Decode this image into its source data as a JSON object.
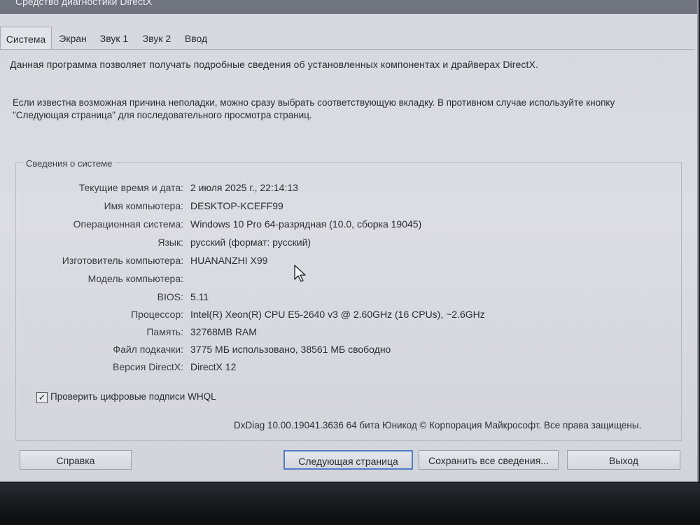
{
  "window": {
    "title": "Средство диагностики DirectX"
  },
  "tabs": [
    {
      "label": "Система",
      "active": true
    },
    {
      "label": "Экран"
    },
    {
      "label": "Звук 1"
    },
    {
      "label": "Звук 2"
    },
    {
      "label": "Ввод"
    }
  ],
  "intro": "Данная программа позволяет получать подробные сведения об установленных компонентах и драйверах DirectX.",
  "hint": "Если известна возможная причина неполадки, можно сразу выбрать соответствующую вкладку. В противном случае используйте кнопку \"Следующая страница\" для последовательного просмотра страниц.",
  "system_info": {
    "title": "Сведения о системе",
    "rows": [
      {
        "label": "Текущие время и дата:",
        "value": "2 июля 2025 г., 22:14:13"
      },
      {
        "label": "Имя компьютера:",
        "value": "DESKTOP-KCEFF99"
      },
      {
        "label": "Операционная система:",
        "value": "Windows 10 Pro 64-разрядная (10.0, сборка 19045)"
      },
      {
        "label": "Язык:",
        "value": "русский (формат: русский)"
      },
      {
        "label": "Изготовитель компьютера:",
        "value": "HUANANZHI X99"
      },
      {
        "label": "Модель компьютера:",
        "value": ""
      },
      {
        "label": "BIOS:",
        "value": "5.11"
      },
      {
        "label": "Процессор:",
        "value": "Intel(R) Xeon(R) CPU E5-2640 v3 @ 2.60GHz (16 CPUs), ~2.6GHz"
      },
      {
        "label": "Память:",
        "value": "32768MB RAM"
      },
      {
        "label": "Файл подкачки:",
        "value": "3775 МБ использовано, 38561 МБ свободно"
      },
      {
        "label": "Версия DirectX:",
        "value": "DirectX 12"
      }
    ]
  },
  "whql": {
    "label": "Проверить цифровые подписи WHQL",
    "checked": true,
    "mark": "✓"
  },
  "footer": "DxDiag 10.00.19041.3636 64 бита Юникод © Корпорация Майкрософт. Все права защищены.",
  "buttons": {
    "help": "Справка",
    "next": "Следующая страница",
    "save": "Сохранить все сведения...",
    "exit": "Выход"
  }
}
